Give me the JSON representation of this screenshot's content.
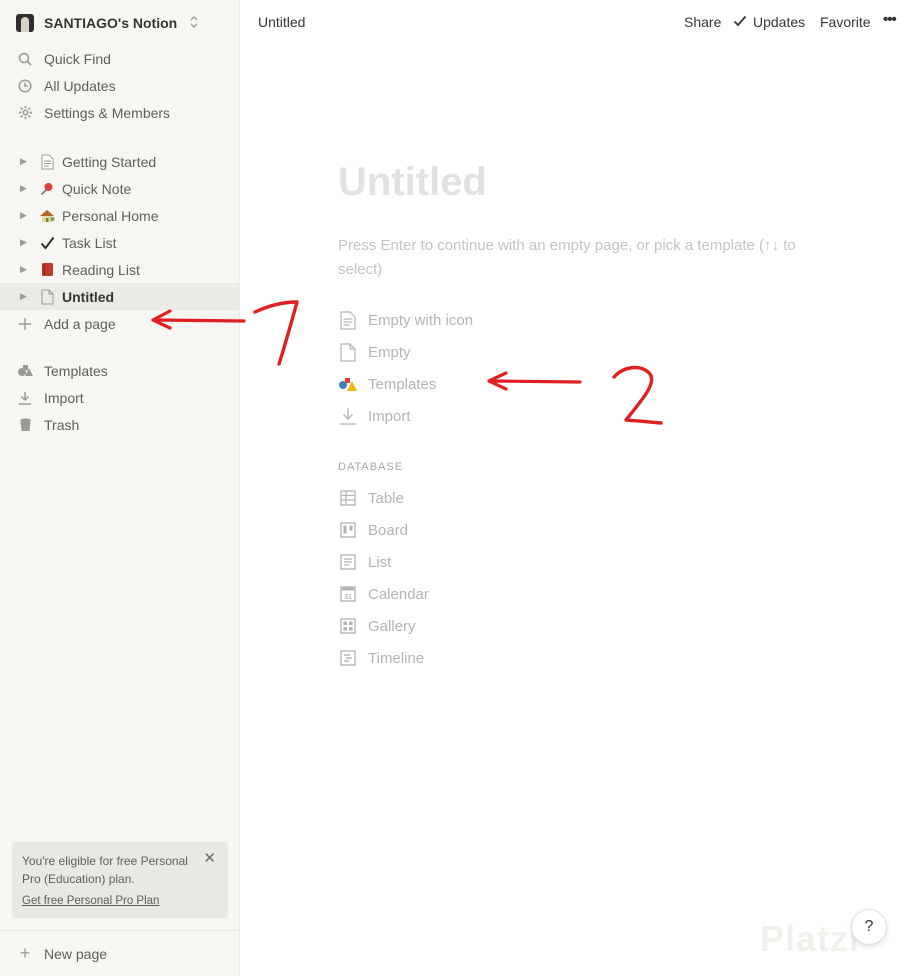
{
  "workspace": {
    "name": "SANTIAGO's Notion",
    "chevron": "⌃⌄"
  },
  "sidebar": {
    "top_items": [
      {
        "label": "Quick Find",
        "icon": "search-icon"
      },
      {
        "label": "All Updates",
        "icon": "clock-icon"
      },
      {
        "label": "Settings & Members",
        "icon": "gear-icon"
      }
    ],
    "pages": [
      {
        "label": "Getting Started",
        "icon": "document-icon",
        "emoji": "📄"
      },
      {
        "label": "Quick Note",
        "icon": "pushpin-icon",
        "emoji": "📌"
      },
      {
        "label": "Personal Home",
        "icon": "house-icon",
        "emoji": "🏡"
      },
      {
        "label": "Task List",
        "icon": "checkmark-icon",
        "emoji": "✔"
      },
      {
        "label": "Reading List",
        "icon": "book-icon",
        "emoji": "📕"
      },
      {
        "label": "Untitled",
        "icon": "page-icon",
        "emoji": "🗋"
      }
    ],
    "add_page": "Add a page",
    "bottom_items": [
      {
        "label": "Templates",
        "icon": "templates-icon"
      },
      {
        "label": "Import",
        "icon": "download-icon"
      },
      {
        "label": "Trash",
        "icon": "trash-icon"
      }
    ],
    "promo": {
      "text": "You're eligible for free Personal Pro (Education) plan.",
      "link": "Get free Personal Pro Plan",
      "close": "✕"
    },
    "new_page": "New page"
  },
  "topbar": {
    "breadcrumb": "Untitled",
    "share": "Share",
    "updates": "Updates",
    "favorite": "Favorite",
    "more": "•••"
  },
  "page": {
    "title_placeholder": "Untitled",
    "hint": "Press Enter to continue with an empty page, or pick a template (↑↓ to select)",
    "options": [
      {
        "label": "Empty with icon",
        "icon": "document-lines-icon"
      },
      {
        "label": "Empty",
        "icon": "blank-page-icon"
      },
      {
        "label": "Templates",
        "icon": "templates-shapes-icon"
      },
      {
        "label": "Import",
        "icon": "import-icon"
      }
    ],
    "database_header": "DATABASE",
    "database_options": [
      {
        "label": "Table",
        "icon": "table-icon"
      },
      {
        "label": "Board",
        "icon": "board-icon"
      },
      {
        "label": "List",
        "icon": "list-icon"
      },
      {
        "label": "Calendar",
        "icon": "calendar-icon"
      },
      {
        "label": "Gallery",
        "icon": "gallery-icon"
      },
      {
        "label": "Timeline",
        "icon": "timeline-icon"
      }
    ]
  },
  "annotations": {
    "one": "1",
    "two": "2"
  },
  "help": "?",
  "watermark": "Platzi",
  "colors": {
    "sidebar_bg": "#f7f6f3",
    "annotation": "#e02020",
    "text": "#37352f"
  }
}
